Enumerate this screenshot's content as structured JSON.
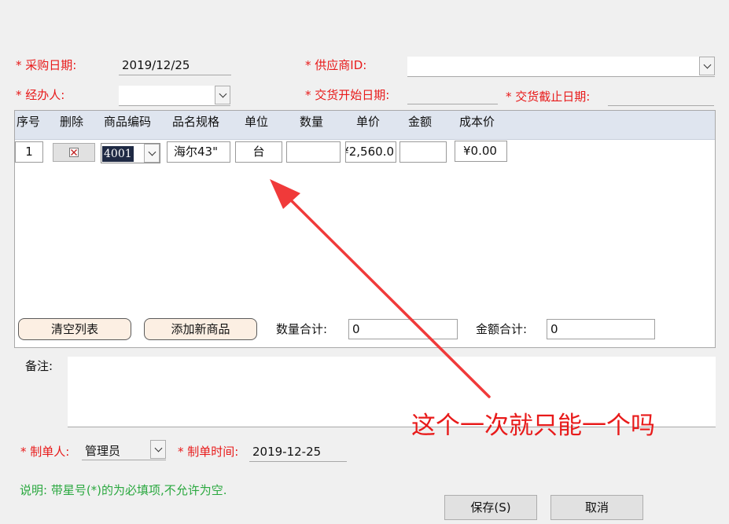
{
  "header": {
    "purchase_date_label": "* 采购日期:",
    "purchase_date_value": "2019/12/25",
    "supplier_label": "* 供应商ID:",
    "supplier_value": "",
    "handler_label": "* 经办人:",
    "handler_value": "",
    "delivery_start_label": "* 交货开始日期:",
    "delivery_start_value": "",
    "delivery_end_label": "* 交货截止日期:",
    "delivery_end_value": ""
  },
  "grid": {
    "columns": [
      "序号",
      "删除",
      "商品编码",
      "品名规格",
      "单位",
      "数量",
      "单价",
      "金额",
      "成本价"
    ],
    "row": {
      "index": "1",
      "code": "4001",
      "spec": "海尔43\"",
      "unit": "台",
      "qty": "",
      "price": "¥2,560.0",
      "amount": "",
      "cost": "¥0.00"
    }
  },
  "actions": {
    "clear_label": "清空列表",
    "add_label": "添加新商品",
    "qty_total_label": "数量合计:",
    "qty_total_value": "0",
    "amount_total_label": "金额合计:",
    "amount_total_value": "0"
  },
  "remarks": {
    "label": "备注:",
    "value": ""
  },
  "footer": {
    "creator_label": "* 制单人:",
    "creator_value": "管理员",
    "created_time_label": "* 制单时间:",
    "created_time_value": "2019-12-25",
    "note": "说明: 带星号(*)的为必填项,不允许为空.",
    "save_label": "保存(S)",
    "cancel_label": "取消"
  },
  "annotation": {
    "text": "这个一次就只能一个吗",
    "color": "#e81a1a"
  }
}
